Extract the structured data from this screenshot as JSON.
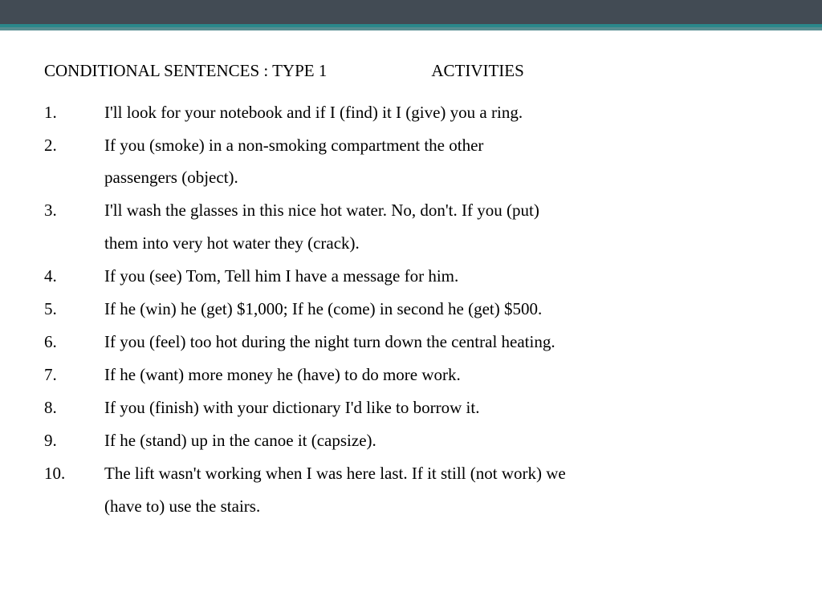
{
  "heading": {
    "left": "CONDITIONAL SENTENCES : TYPE 1",
    "right": "ACTIVITIES"
  },
  "items": [
    {
      "num": "1.",
      "lines": [
        "I'll look for your notebook and if I (find) it I (give) you a ring."
      ]
    },
    {
      "num": "2.",
      "lines": [
        "If you (smoke) in a non-smoking compartment the other",
        "passengers (object)."
      ]
    },
    {
      "num": "3.",
      "lines": [
        "I'll wash the glasses in this nice hot water. No, don't. If you (put)",
        "them into very hot water they (crack)."
      ]
    },
    {
      "num": "4.",
      "lines": [
        "If you (see) Tom, Tell him I have a message for him."
      ]
    },
    {
      "num": "5.",
      "lines": [
        "If he (win) he (get) $1,000; If he (come) in second he (get) $500."
      ]
    },
    {
      "num": "6.",
      "lines": [
        "If you (feel) too hot during the night turn down the central heating."
      ]
    },
    {
      "num": "7.",
      "lines": [
        "If he (want) more money he (have) to do more work."
      ]
    },
    {
      "num": "8.",
      "lines": [
        "If you (finish) with your dictionary I'd like to borrow it."
      ]
    },
    {
      "num": "9.",
      "lines": [
        "If he (stand) up in the canoe it (capsize)."
      ]
    },
    {
      "num": "10.",
      "lines": [
        "The lift wasn't working when I was here last. If it still (not work) we",
        "(have to) use the stairs."
      ]
    }
  ]
}
